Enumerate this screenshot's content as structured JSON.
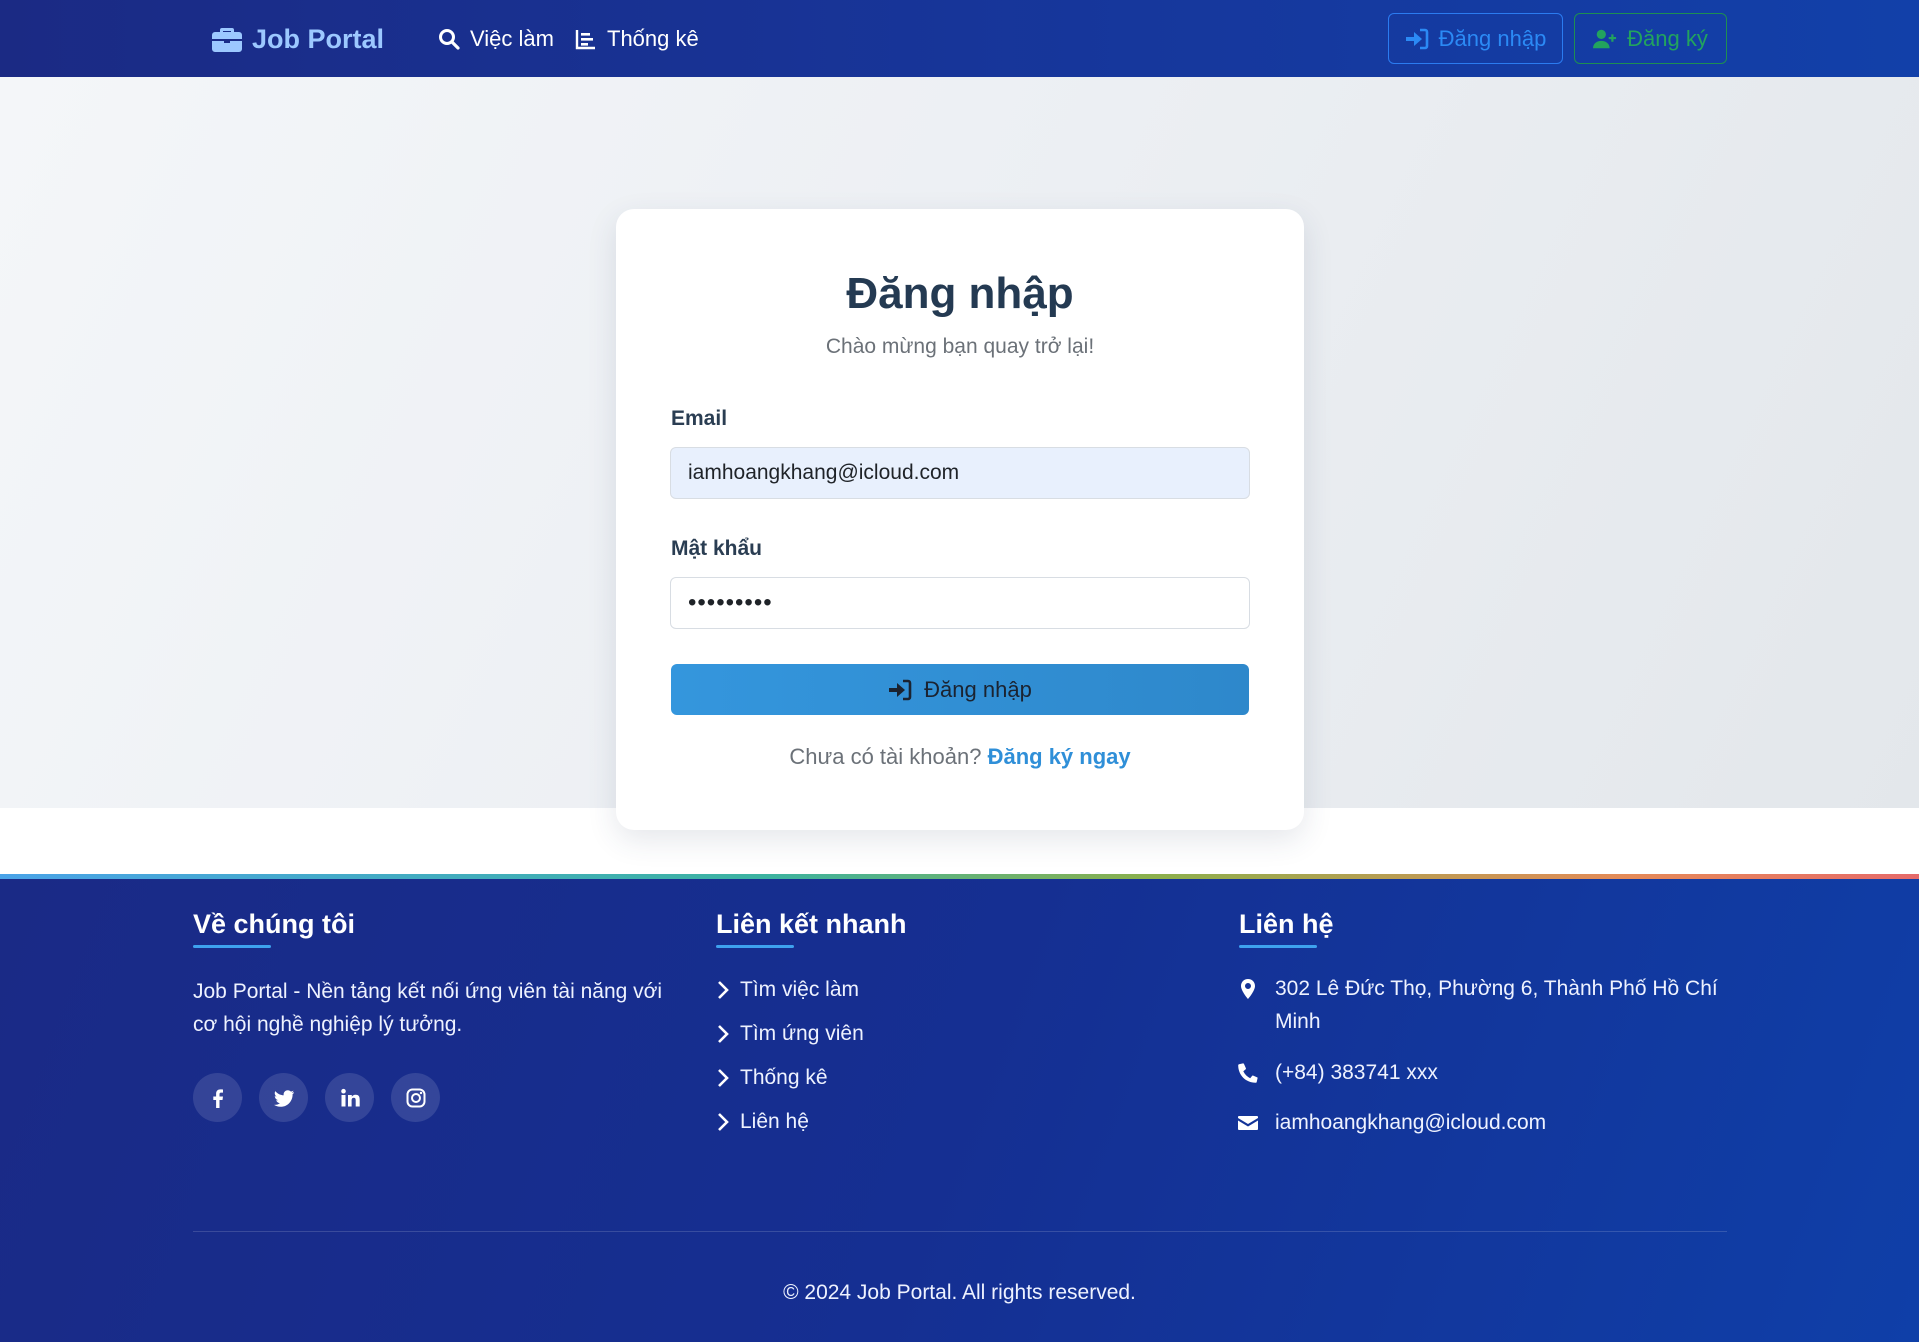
{
  "navbar": {
    "brand": "Job Portal",
    "links": [
      {
        "label": "Việc làm",
        "icon": "search-icon"
      },
      {
        "label": "Thống kê",
        "icon": "chart-icon"
      }
    ],
    "login_label": "Đăng nhập",
    "register_label": "Đăng ký",
    "colors": {
      "login": "#2b8af5",
      "register": "#22a35e",
      "brand": "#9cc8ff"
    }
  },
  "login_card": {
    "title": "Đăng nhập",
    "subtitle": "Chào mừng bạn quay trở lại!",
    "email_label": "Email",
    "email_value": "iamhoangkhang@icloud.com",
    "password_label": "Mật khẩu",
    "password_value": "•••••••••",
    "submit_label": "Đăng nhập",
    "no_account_text": "Chưa có tài khoản?",
    "register_link": "Đăng ký ngay"
  },
  "footer": {
    "about": {
      "heading": "Về chúng tôi",
      "text": "Job Portal - Nền tảng kết nối ứng viên tài năng với cơ hội nghề nghiệp lý tưởng.",
      "social": [
        "facebook-icon",
        "twitter-icon",
        "linkedin-icon",
        "instagram-icon"
      ]
    },
    "quick_links": {
      "heading": "Liên kết nhanh",
      "items": [
        "Tìm việc làm",
        "Tìm ứng viên",
        "Thống kê",
        "Liên hệ"
      ]
    },
    "contact": {
      "heading": "Liên hệ",
      "address": "302 Lê Đức Thọ, Phường 6, Thành Phố Hồ Chí Minh",
      "phone": "(+84) 383741 xxx",
      "email": "iamhoangkhang@icloud.com"
    },
    "copyright": "© 2024 Job Portal. All rights reserved."
  }
}
